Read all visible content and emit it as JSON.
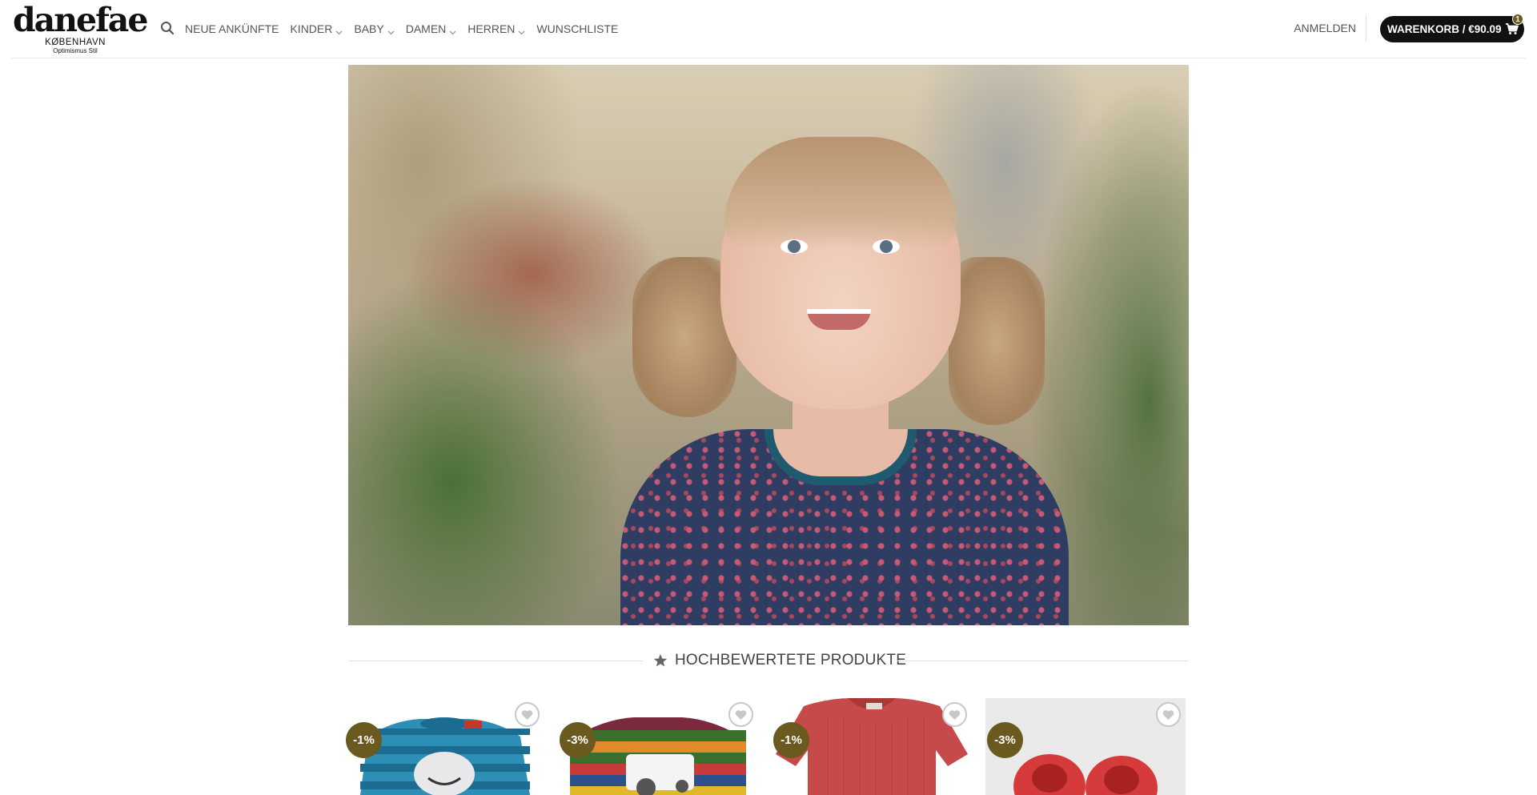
{
  "logo": {
    "brand": "danefae",
    "city": "KØBENHAVN",
    "tagline": "Optimismus Stil"
  },
  "nav": {
    "search_icon": "search-icon",
    "items": [
      {
        "label": "NEUE ANKÜNFTE",
        "dropdown": false
      },
      {
        "label": "KINDER",
        "dropdown": true
      },
      {
        "label": "BABY",
        "dropdown": true
      },
      {
        "label": "DAMEN",
        "dropdown": true
      },
      {
        "label": "HERREN",
        "dropdown": true
      },
      {
        "label": "WUNSCHLISTE",
        "dropdown": false
      }
    ]
  },
  "account": {
    "login_label": "ANMELDEN"
  },
  "cart": {
    "label": "WARENKORB / €90.09",
    "count": "1",
    "icon": "cart-icon"
  },
  "hero": {
    "alt": "hero-photo"
  },
  "section": {
    "title": "HOCHBEWERTETE PRODUKTE",
    "icon": "star-icon"
  },
  "products": [
    {
      "badge": "-1%",
      "wishlist_icon": "heart-icon"
    },
    {
      "badge": "-3%",
      "wishlist_icon": "heart-icon"
    },
    {
      "badge": "-1%",
      "wishlist_icon": "heart-icon"
    },
    {
      "badge": "-3%",
      "wishlist_icon": "heart-icon"
    }
  ],
  "colors": {
    "accent": "#111111",
    "badge": "#6b5a20",
    "nav_text": "#555555"
  }
}
